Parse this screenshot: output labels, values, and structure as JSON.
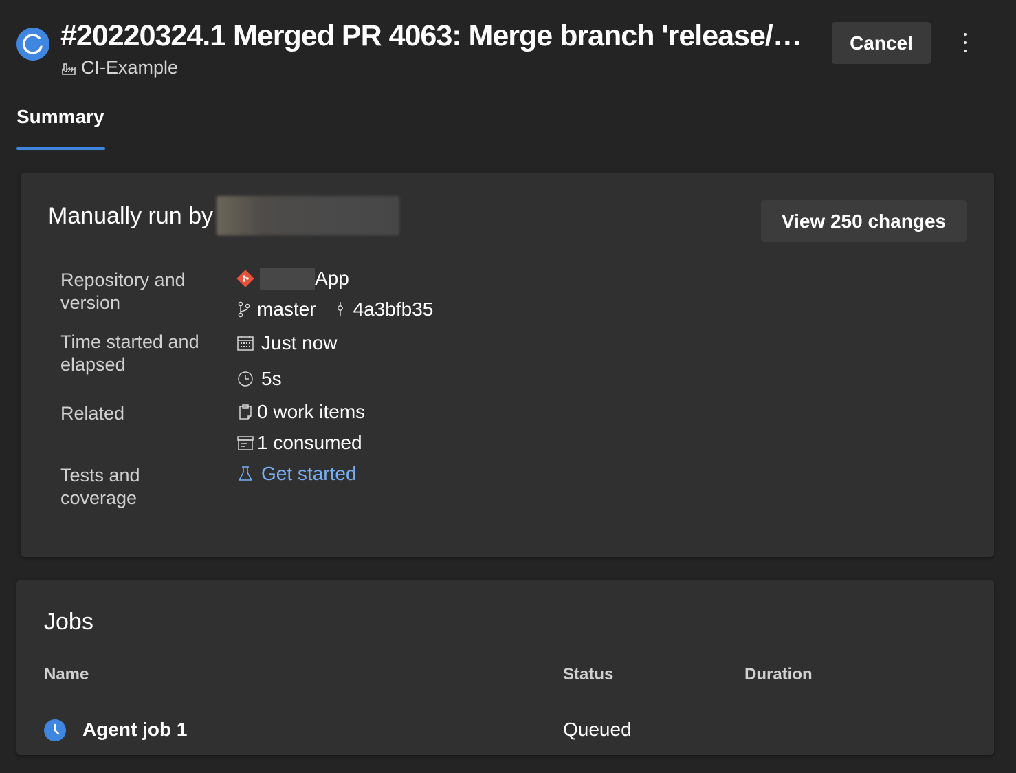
{
  "header": {
    "title": "#20220324.1 Merged PR 4063: Merge branch 'release/2...",
    "pipeline_name": "CI-Example",
    "cancel_label": "Cancel",
    "status_color": "#3f86e0"
  },
  "tabs": [
    {
      "label": "Summary",
      "selected": true
    }
  ],
  "summary": {
    "run_by_prefix": "Manually run by",
    "view_changes_label": "View 250 changes",
    "details": {
      "repository_label": "Repository and version",
      "repository_name_suffix": "App",
      "branch": "master",
      "commit": "4a3bfb35",
      "time_label": "Time started and elapsed",
      "started": "Just now",
      "elapsed": "5s",
      "related_label": "Related",
      "work_items": "0 work items",
      "consumed": "1 consumed",
      "tests_label": "Tests and coverage",
      "tests_link": "Get started"
    },
    "colors": {
      "git_icon": "#e8523a",
      "link": "#79aef2"
    }
  },
  "jobs": {
    "title": "Jobs",
    "columns": [
      "Name",
      "Status",
      "Duration"
    ],
    "rows": [
      {
        "name": "Agent job 1",
        "status": "Queued",
        "duration": ""
      }
    ]
  }
}
